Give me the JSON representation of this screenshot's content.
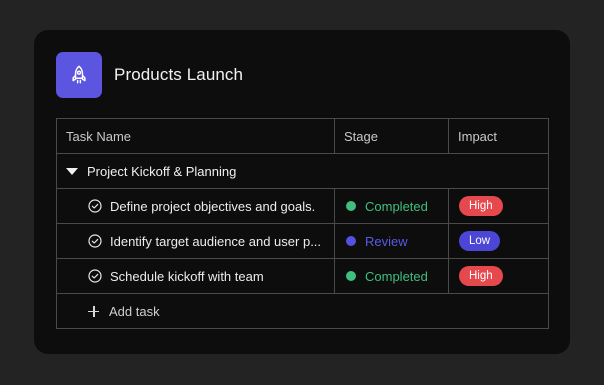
{
  "project": {
    "title": "Products Launch",
    "icon": "rocket-icon",
    "accent": "#5b55e0"
  },
  "table": {
    "columns": [
      "Task Name",
      "Stage",
      "Impact"
    ],
    "group": {
      "label": "Project Kickoff & Planning",
      "expanded": true
    },
    "rows": [
      {
        "task": "Define project objectives and goals.",
        "stage": "Completed",
        "stage_color": "#3fbf7f",
        "impact": "High",
        "impact_color": "#e5484d"
      },
      {
        "task": "Identify target audience and user p...",
        "stage": "Review",
        "stage_color": "#5451e0",
        "impact": "Low",
        "impact_color": "#4c46d6"
      },
      {
        "task": "Schedule kickoff with team",
        "stage": "Completed",
        "stage_color": "#3fbf7f",
        "impact": "High",
        "impact_color": "#e5484d"
      }
    ],
    "add_label": "Add task"
  }
}
